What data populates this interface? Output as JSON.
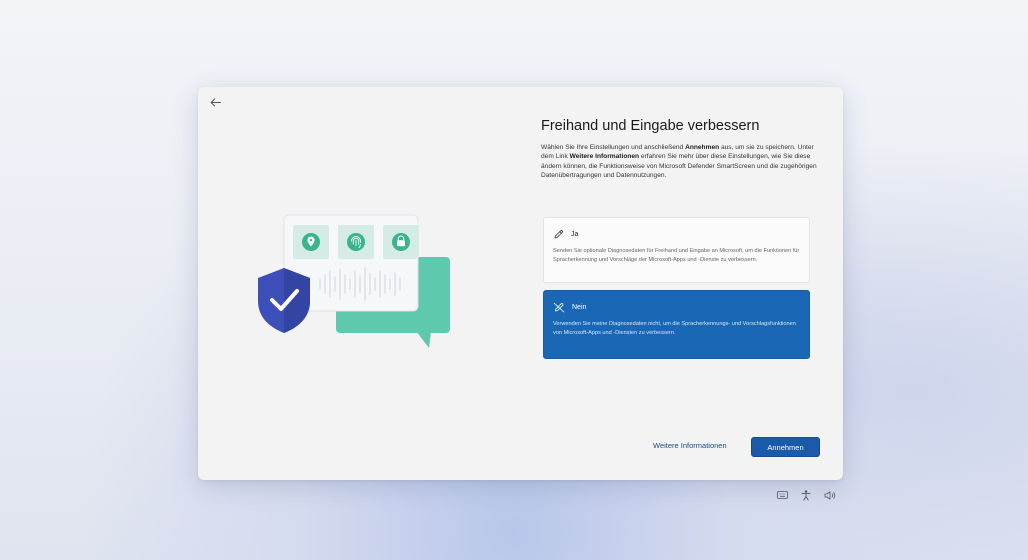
{
  "page": {
    "title": "Freihand und Eingabe verbessern",
    "description": {
      "p1": "Wählen Sie Ihre Einstellungen und anschließend ",
      "b1": "Annehmen",
      "p2": " aus, um sie zu speichern. Unter dem Link ",
      "b2": "Weitere Informationen",
      "p3": " erfahren Sie mehr über diese Einstellungen, wie Sie diese ändern können, die Funktionsweise von Microsoft Defender SmartScreen und die zugehörigen Datenübertragungen und Datennutzungen."
    }
  },
  "options": [
    {
      "label": "Ja",
      "icon": "pen-icon",
      "text": "Senden Sie optionale Diagnosedaten für Freihand und Eingabe an Microsoft, um die Funktionen für Spracherkennung und Vorschläge der Microsoft-Apps und -Dienste zu verbessern.",
      "selected": false
    },
    {
      "label": "Nein",
      "icon": "pen-off-icon",
      "text": "Verwenden Sie meine Diagnosedaten nicht, um die Spracherkennungs- und Vorschlagsfunktionen von Microsoft-Apps und -Diensten zu verbessern.",
      "selected": true
    }
  ],
  "footer": {
    "more_info_label": "Weitere Informationen",
    "accept_label": "Annehmen"
  },
  "tray_icons": [
    "keyboard-icon",
    "accessibility-icon",
    "volume-icon"
  ],
  "colors": {
    "accent": "#1a5aa8",
    "selected_option": "#1a67b5",
    "shield": "#3d4fb8",
    "bubble": "#5ec9ad"
  }
}
